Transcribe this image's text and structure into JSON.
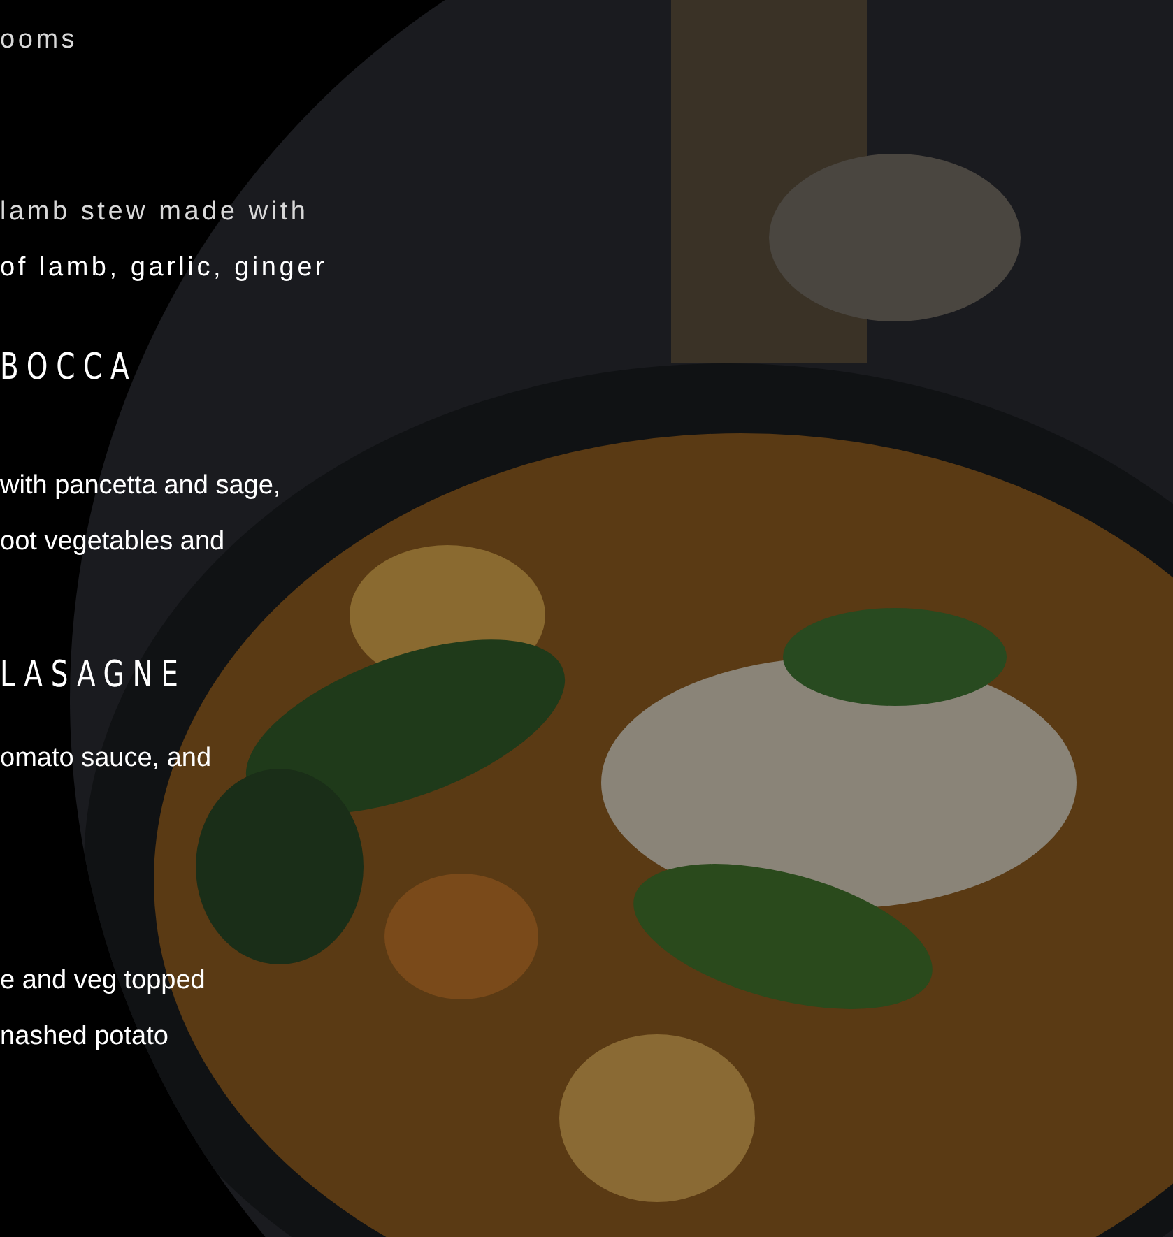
{
  "blocks": [
    {
      "kind": "spaced_text",
      "lines": [
        "ooms"
      ]
    },
    {
      "kind": "spaced_text",
      "lines": [
        "lamb stew made with",
        "of lamb, garlic, ginger"
      ]
    },
    {
      "kind": "title",
      "lines": [
        "BOCCA"
      ]
    },
    {
      "kind": "text",
      "lines": [
        "with pancetta and sage,",
        "oot vegetables and"
      ]
    },
    {
      "kind": "title",
      "lines": [
        "LASAGNE"
      ]
    },
    {
      "kind": "text",
      "lines": [
        "omato sauce, and"
      ]
    },
    {
      "kind": "text",
      "lines": [
        "e and veg topped",
        "nashed potato"
      ]
    }
  ]
}
